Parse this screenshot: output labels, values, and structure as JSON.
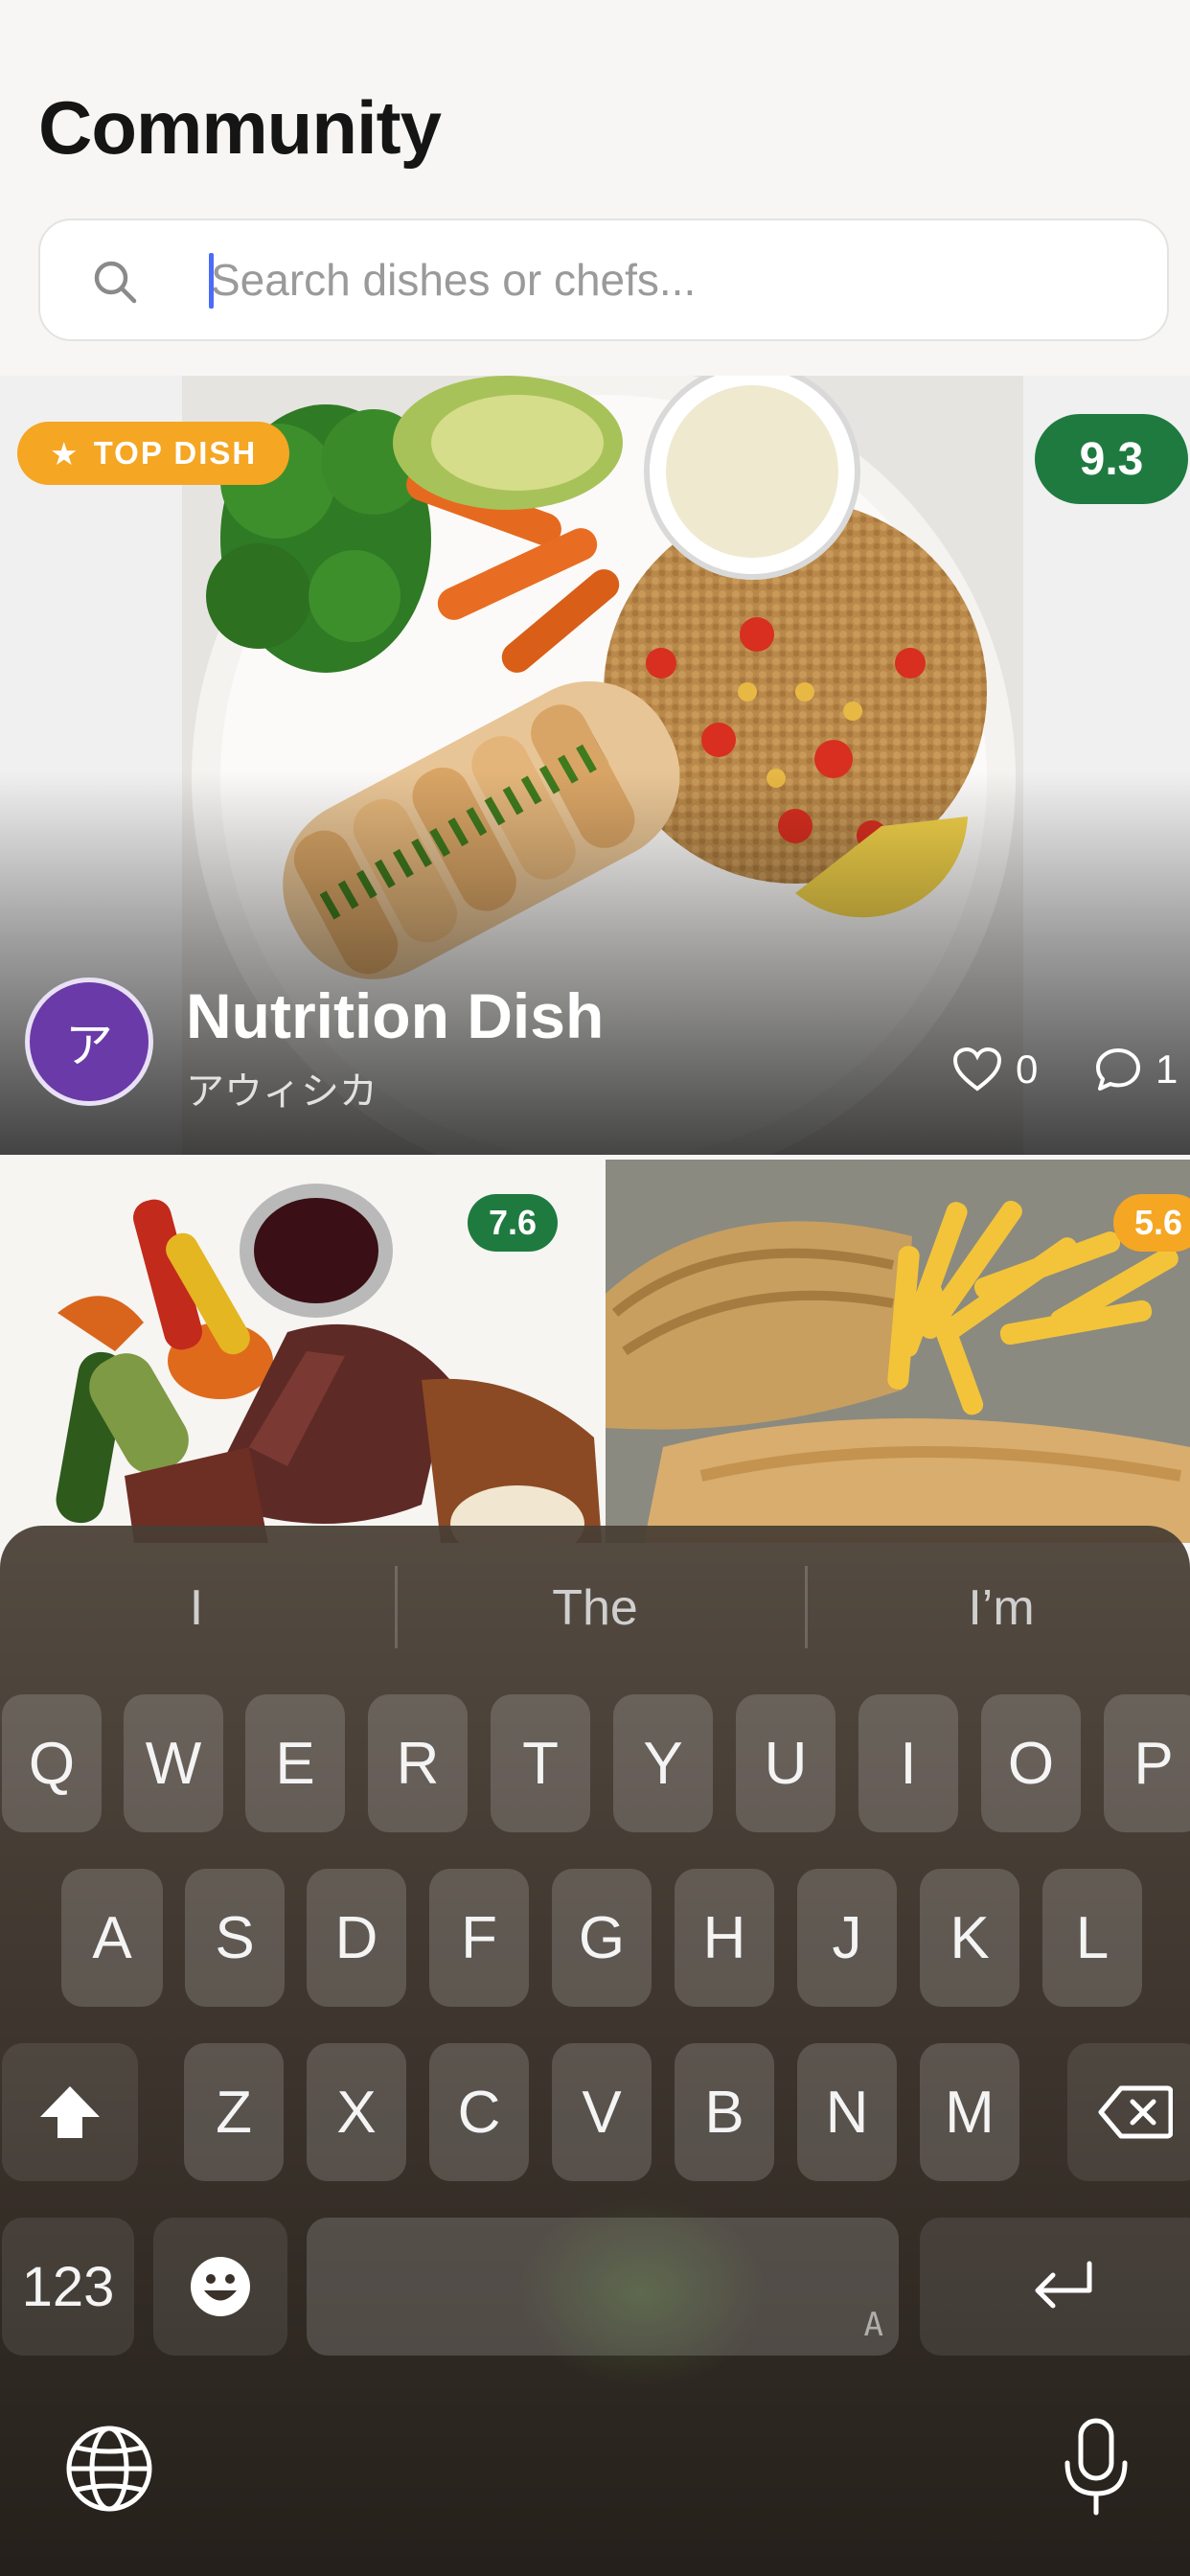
{
  "header": {
    "title": "Community"
  },
  "search": {
    "placeholder": "Search dishes or chefs..."
  },
  "featured": {
    "badge": "TOP DISH",
    "badge_icon": "star-icon",
    "score": "9.3",
    "score_color": "#1f7a40",
    "title": "Nutrition Dish",
    "author": "アウィシカ",
    "avatar_initial": "ア",
    "likes": "0",
    "comments": "1"
  },
  "grid": [
    {
      "score": "7.6",
      "score_color": "#1f7a40"
    },
    {
      "score": "5.6",
      "score_color": "#f5a623"
    }
  ],
  "keyboard": {
    "suggestions": [
      "I",
      "The",
      "I’m"
    ],
    "row1": [
      "Q",
      "W",
      "E",
      "R",
      "T",
      "Y",
      "U",
      "I",
      "O",
      "P"
    ],
    "row2": [
      "A",
      "S",
      "D",
      "F",
      "G",
      "H",
      "J",
      "K",
      "L"
    ],
    "row3": [
      "Z",
      "X",
      "C",
      "V",
      "B",
      "N",
      "M"
    ],
    "numbers_key": "123",
    "space_hint": "A"
  }
}
